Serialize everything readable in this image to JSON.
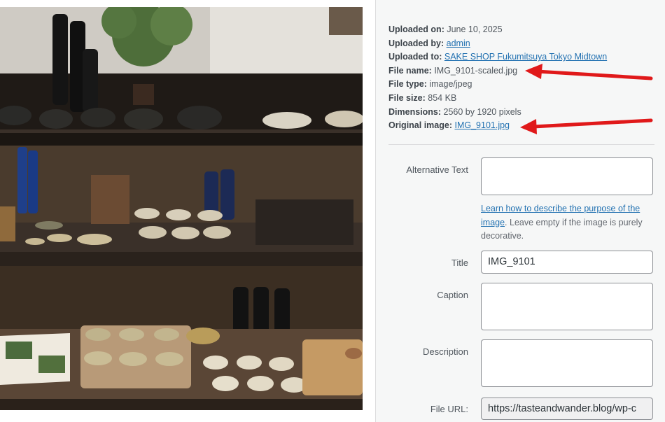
{
  "meta": {
    "uploaded_on_label": "Uploaded on:",
    "uploaded_on": "June 10, 2025",
    "uploaded_by_label": "Uploaded by:",
    "uploaded_by": "admin",
    "uploaded_to_label": "Uploaded to:",
    "uploaded_to": "SAKE SHOP Fukumitsuya Tokyo Midtown",
    "file_name_label": "File name:",
    "file_name": "IMG_9101-scaled.jpg",
    "file_type_label": "File type:",
    "file_type": "image/jpeg",
    "file_size_label": "File size:",
    "file_size": "854 KB",
    "dimensions_label": "Dimensions:",
    "dimensions": "2560 by 1920 pixels",
    "original_image_label": "Original image:",
    "original_image": "IMG_9101.jpg"
  },
  "fields": {
    "alt_text_label": "Alternative Text",
    "alt_text_value": "",
    "alt_help_link": "Learn how to describe the purpose of the image",
    "alt_help_text": ". Leave empty if the image is purely decorative.",
    "title_label": "Title",
    "title_value": "IMG_9101",
    "caption_label": "Caption",
    "caption_value": "",
    "description_label": "Description",
    "description_value": "",
    "file_url_label": "File URL:",
    "file_url_value": "https://tasteandwander.blog/wp-c"
  },
  "colors": {
    "link": "#2271b1",
    "annotation_arrow": "#e0191a"
  }
}
